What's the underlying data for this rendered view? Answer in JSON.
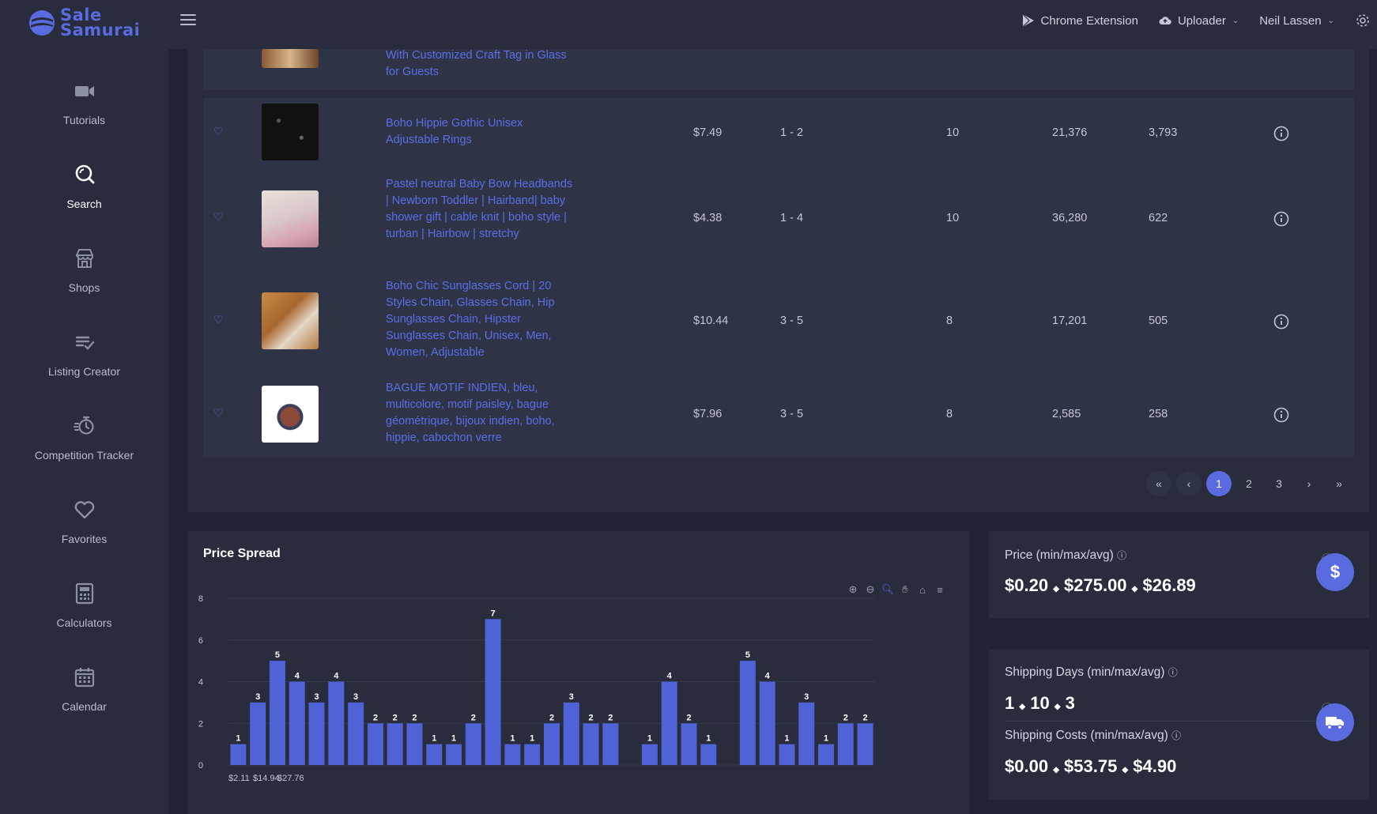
{
  "app": {
    "logo_line1": "Sale",
    "logo_line2": "Samurai"
  },
  "topbar": {
    "chrome_extension": "Chrome Extension",
    "uploader": "Uploader",
    "user": "Neil Lassen"
  },
  "sidebar": {
    "items": [
      {
        "label": "Tutorials",
        "icon": "video-camera-icon"
      },
      {
        "label": "Search",
        "icon": "search-icon",
        "active": true
      },
      {
        "label": "Shops",
        "icon": "shop-icon"
      },
      {
        "label": "Listing Creator",
        "icon": "list-check-icon"
      },
      {
        "label": "Competition Tracker",
        "icon": "stopwatch-icon"
      },
      {
        "label": "Favorites",
        "icon": "heart-icon"
      },
      {
        "label": "Calculators",
        "icon": "calculator-icon"
      },
      {
        "label": "Calendar",
        "icon": "calendar-icon"
      }
    ]
  },
  "listings": {
    "partial_row_title": "With Customized Craft Tag in Glass for Guests",
    "rows": [
      {
        "title": "Boho Hippie Gothic Unisex Adjustable Rings",
        "price": "$7.49",
        "ship_days": "1 - 2",
        "col3": "10",
        "col4": "21,376",
        "col5": "3,793"
      },
      {
        "title": "Pastel neutral Baby Bow Headbands | Newborn Toddler | Hairband| baby shower gift | cable knit | boho style | turban | Hairbow | stretchy",
        "price": "$4.38",
        "ship_days": "1 - 4",
        "col3": "10",
        "col4": "36,280",
        "col5": "622"
      },
      {
        "title": "Boho Chic Sunglasses Cord | 20 Styles Chain, Glasses Chain, Hip Sunglasses Chain, Hipster Sunglasses Chain, Unisex, Men, Women, Adjustable",
        "price": "$10.44",
        "ship_days": "3 - 5",
        "col3": "8",
        "col4": "17,201",
        "col5": "505"
      },
      {
        "title": "BAGUE MOTIF INDIEN, bleu, multicolore, motif paisley, bague géométrique, bijoux indien, boho, hippie, cabochon verre",
        "price": "$7.96",
        "ship_days": "3 - 5",
        "col3": "8",
        "col4": "2,585",
        "col5": "258"
      }
    ]
  },
  "pagination": {
    "first": "«",
    "prev": "‹",
    "pages": [
      "1",
      "2",
      "3"
    ],
    "current": "1",
    "next": "›",
    "last": "»"
  },
  "price_spread": {
    "title": "Price Spread"
  },
  "chart_data": {
    "type": "bar",
    "title": "Price Spread",
    "ylim": [
      0,
      8
    ],
    "yticks": [
      "0",
      "2",
      "4",
      "6",
      "8"
    ],
    "visible_x_labels": [
      "$2.11",
      "$14.94",
      "$27.76"
    ],
    "values": [
      1,
      3,
      5,
      4,
      3,
      4,
      3,
      2,
      2,
      2,
      1,
      1,
      2,
      7,
      1,
      1,
      2,
      3,
      2,
      2,
      0,
      1,
      4,
      2,
      1,
      0,
      5,
      4,
      1,
      3,
      1,
      2,
      2
    ],
    "grid": true,
    "bar_color": "#4f63d6"
  },
  "stats": {
    "price_label": "Price (min/max/avg)",
    "price_min": "$0.20",
    "price_max": "$275.00",
    "price_avg": "$26.89",
    "ship_days_label": "Shipping Days (min/max/avg)",
    "ship_days_min": "1",
    "ship_days_max": "10",
    "ship_days_avg": "3",
    "ship_costs_label": "Shipping Costs (min/max/avg)",
    "ship_cost_min": "$0.00",
    "ship_cost_max": "$53.75",
    "ship_cost_avg": "$4.90",
    "sep": "◆",
    "price_badge": "$"
  },
  "colors": {
    "accent": "#5a6be0",
    "bg": "#212433",
    "panel": "#282c3c",
    "row": "#2f3346"
  }
}
